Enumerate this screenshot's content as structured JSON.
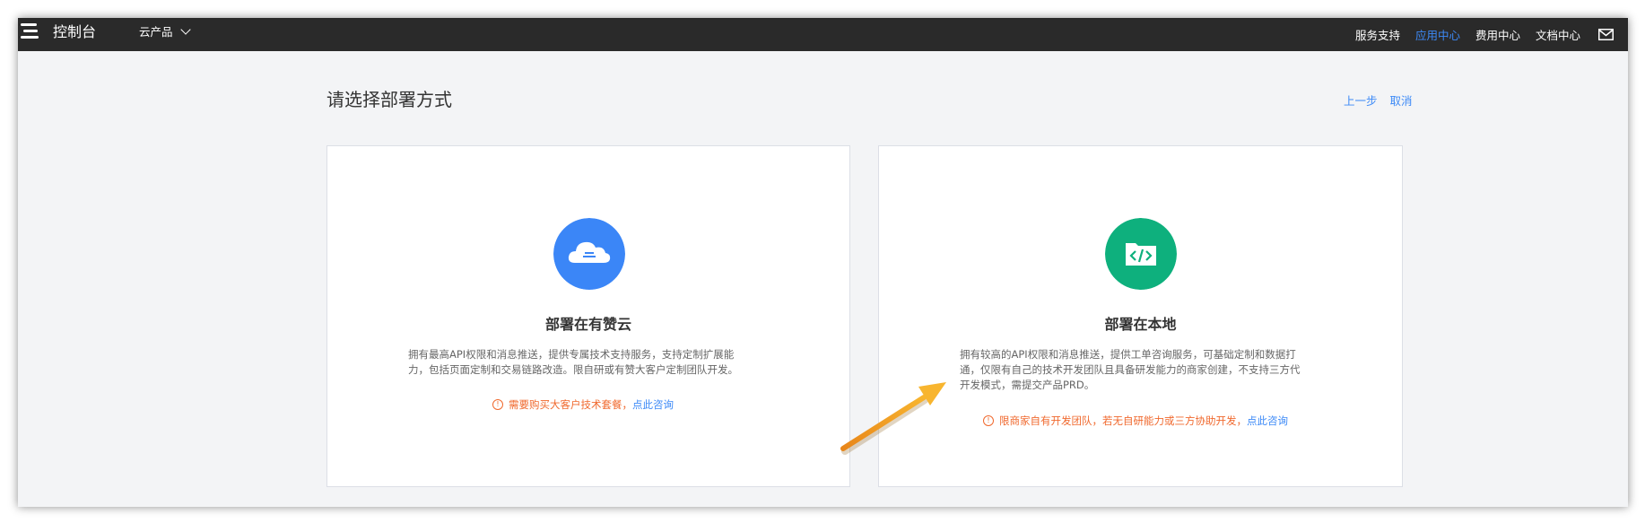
{
  "topbar": {
    "brand": "控制台",
    "products_label": "云产品",
    "nav": [
      "服务支持",
      "应用中心",
      "费用中心",
      "文档中心"
    ],
    "active_nav": "应用中心"
  },
  "page": {
    "title": "请选择部署方式",
    "prev_label": "上一步",
    "cancel_label": "取消"
  },
  "cards": [
    {
      "title": "部署在有赞云",
      "desc_lines": [
        "拥有最高API权限和消息推送，提供专属技术支持服务，支持定制扩展能",
        "力，包括页面定制和交易链路改造。限自研或有赞大客户定制团队开发。"
      ],
      "warning": "需要购买大客户技术套餐，",
      "link": "点此咨询",
      "icon": "cloud-icon",
      "icon_color": "#3b86f7"
    },
    {
      "title": "部署在本地",
      "desc_lines": [
        "拥有较高的API权限和消息推送，提供工单咨询服务，可基础定制和数据打",
        "通，仅限有自己的技术开发团队且具备研发能力的商家创建，不支持三方代",
        "开发模式，需提交产品PRD。"
      ],
      "warning": "限商家自有开发团队，若无自研能力或三方协助开发，",
      "link": "点此咨询",
      "icon": "code-folder-icon",
      "icon_color": "#0eb07d"
    }
  ],
  "colors": {
    "topbar_bg": "#2a2a2a",
    "accent": "#3d8af7",
    "warning": "#f0692e",
    "annotation_arrow": "#f5a020"
  }
}
